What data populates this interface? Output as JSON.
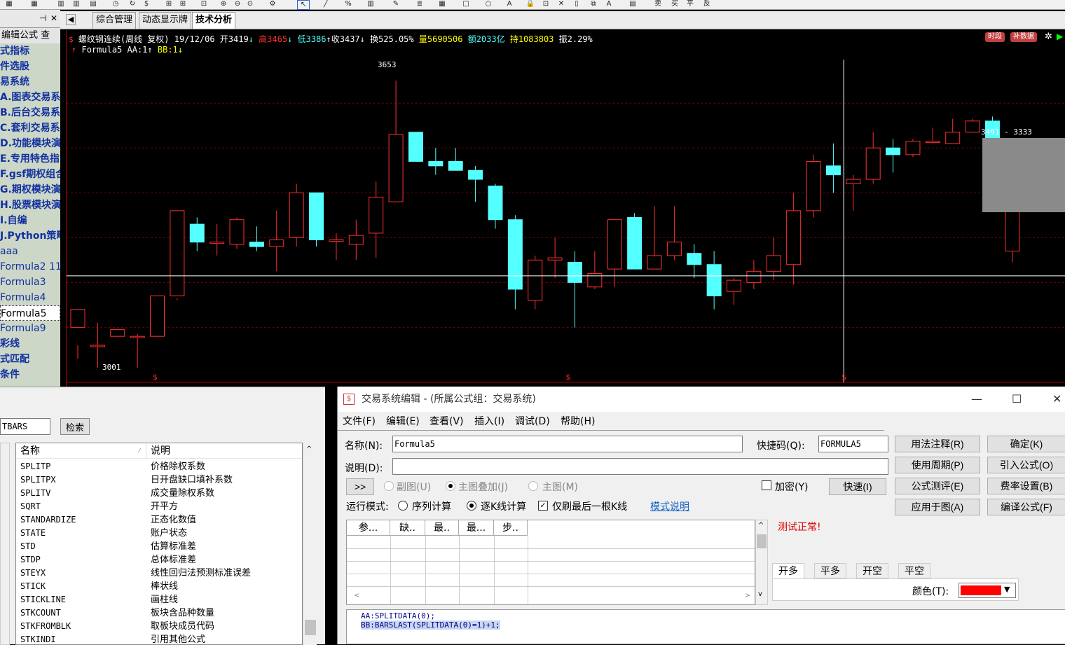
{
  "left_panel": {
    "sub": "编辑公式  查",
    "items": [
      "式指标",
      "件选股",
      "易系统",
      "A.图表交易系",
      "B.后台交易系",
      "C.套利交易系",
      "D.功能模块演",
      "E.专用特色指",
      "F.gsf期权组合",
      "G.期权模块演",
      "H.股票模块演",
      "I.自编",
      "J.Python策略",
      "aaa",
      "Formula2 11",
      "Formula3",
      "Formula4",
      "Formula5",
      "Formula9",
      "彩线",
      "式匹配",
      "条件"
    ]
  },
  "tabs": [
    "综合管理",
    "动态显示牌",
    "技术分析"
  ],
  "chart": {
    "title": "螺纹钢连续(周线 复权) 19/12/06",
    "open": "开3419",
    "high": "高3465",
    "low": "低3386",
    "close": "收3437",
    "turnover": "换525.05%",
    "volume": "量5690506",
    "amount": "额2033亿",
    "position": "持1083803",
    "amplitude": "振2.29%",
    "formula_line": "Formula5  AA:1",
    "bb": "BB:1",
    "btn_time": "时段",
    "btn_data": "补数据",
    "high_mark": "3653",
    "low_mark": "3001",
    "range_mark": "3491 - 3333",
    "colors": {
      "up": "#ff3030",
      "down": "#54ffff",
      "grid": "#7a0000"
    }
  },
  "chart_data": {
    "type": "candlestick",
    "title": "螺纹钢连续(周线 复权)",
    "ohlc": [
      [
        3100,
        3140,
        3060,
        3030
      ],
      [
        3060,
        3060,
        3110,
        3010
      ],
      [
        3080,
        3095,
        3070,
        3070
      ],
      [
        3080,
        3080,
        3085,
        3010
      ],
      [
        3080,
        3170,
        3060,
        3060
      ],
      [
        3170,
        3360,
        3165,
        3160
      ],
      [
        3330,
        3290,
        3345,
        3270
      ],
      [
        3290,
        3290,
        3330,
        3260
      ],
      [
        3285,
        3340,
        3345,
        3275
      ],
      [
        3290,
        3280,
        3325,
        3270
      ],
      [
        3280,
        3295,
        3360,
        3225
      ],
      [
        3300,
        3400,
        3420,
        3280
      ],
      [
        3400,
        3295,
        3400,
        3280
      ],
      [
        3295,
        3295,
        3310,
        3250
      ],
      [
        3285,
        3305,
        3340,
        3250
      ],
      [
        3310,
        3390,
        3425,
        3255
      ],
      [
        3380,
        3530,
        3650,
        3385
      ],
      [
        3535,
        3470,
        3535,
        3480
      ],
      [
        3470,
        3460,
        3500,
        3440
      ],
      [
        3470,
        3450,
        3500,
        3450
      ],
      [
        3450,
        3430,
        3460,
        3380
      ],
      [
        3415,
        3340,
        3420,
        3320
      ],
      [
        3340,
        3185,
        3350,
        3140
      ],
      [
        3160,
        3250,
        3260,
        3140
      ],
      [
        3250,
        3255,
        3300,
        3210
      ],
      [
        3245,
        3200,
        3270,
        3100
      ],
      [
        3190,
        3220,
        3270,
        3185
      ],
      [
        3230,
        3340,
        3340,
        3190
      ],
      [
        3345,
        3230,
        3355,
        3230
      ],
      [
        3230,
        3260,
        3370,
        3230
      ],
      [
        3260,
        3290,
        3370,
        3250
      ],
      [
        3265,
        3240,
        3285,
        3210
      ],
      [
        3240,
        3170,
        3270,
        3140
      ],
      [
        3180,
        3205,
        3210,
        3150
      ],
      [
        3200,
        3225,
        3250,
        3185
      ],
      [
        3225,
        3260,
        3300,
        3205
      ],
      [
        3240,
        3360,
        3400,
        3195
      ],
      [
        3360,
        3470,
        3485,
        3345
      ],
      [
        3460,
        3440,
        3510,
        3400
      ],
      [
        3420,
        3430,
        3440,
        3360
      ],
      [
        3430,
        3500,
        3535,
        3420
      ],
      [
        3500,
        3485,
        3520,
        3445
      ],
      [
        3485,
        3515,
        3520,
        3480
      ],
      [
        3515,
        3515,
        3545,
        3510
      ],
      [
        3510,
        3535,
        3565,
        3510
      ],
      [
        3535,
        3560,
        3565,
        3535
      ],
      [
        3560,
        3495,
        3570,
        3460
      ],
      [
        3270,
        3380,
        3360,
        3245
      ]
    ],
    "ylim": [
      2990,
      3700
    ],
    "grid": true
  },
  "func_window": {
    "search_value": "TBARS",
    "search_button": "检索",
    "col_name": "名称",
    "col_desc": "说明",
    "rows": [
      {
        "name": "SPLITP",
        "desc": "价格除权系数"
      },
      {
        "name": "SPLITPX",
        "desc": "日开盘缺口填补系数"
      },
      {
        "name": "SPLITV",
        "desc": "成交量除权系数"
      },
      {
        "name": "SQRT",
        "desc": "开平方"
      },
      {
        "name": "STANDARDIZE",
        "desc": "正态化数值"
      },
      {
        "name": "STATE",
        "desc": "账户状态"
      },
      {
        "name": "STD",
        "desc": "估算标准差"
      },
      {
        "name": "STDP",
        "desc": "总体标准差"
      },
      {
        "name": "STEYX",
        "desc": "线性回归法预测标准误差"
      },
      {
        "name": "STICK",
        "desc": "棒状线"
      },
      {
        "name": "STICKLINE",
        "desc": "画柱线"
      },
      {
        "name": "STKCOUNT",
        "desc": "板块含品种数量"
      },
      {
        "name": "STKFROMBLK",
        "desc": "取板块成员代码"
      },
      {
        "name": "STKINDI",
        "desc": "引用其他公式"
      }
    ]
  },
  "editor": {
    "title": "交易系统编辑 - (所属公式组：交易系统)",
    "menu": [
      "文件(F)",
      "编辑(E)",
      "查看(V)",
      "插入(I)",
      "调试(D)",
      "帮助(H)"
    ],
    "name_label": "名称(N):",
    "name_value": "Formula5",
    "shortcut_label": "快捷码(Q):",
    "shortcut_value": "FORMULA5",
    "desc_label": "说明(D):",
    "desc_value": "",
    "expand_btn": ">>",
    "radio_sub": "副图(U)",
    "radio_overlay": "主图叠加(J)",
    "radio_main": "主图(M)",
    "encrypt": "加密(Y)",
    "fast_btn": "快速(I)",
    "run_mode": "运行模式:",
    "seq_calc": "序列计算",
    "bar_calc": "逐K线计算",
    "last_bar": "仅刷最后一根K线",
    "mode_help": "模式说明",
    "param_cols": [
      "参...",
      "缺..",
      "最..",
      "最...",
      "步.."
    ],
    "test_status": "测试正常!",
    "order_tabs": [
      "开多",
      "平多",
      "开空",
      "平空"
    ],
    "color_label": "颜色(T):",
    "color_value": "#ff0000",
    "buttons_right": [
      "用法注释(R)",
      "确定(K)",
      "使用周期(P)",
      "引入公式(O)",
      "公式测评(E)",
      "费率设置(B)",
      "应用于图(A)",
      "编译公式(F)"
    ],
    "code_line1": "AA:SPLITDATA(0);",
    "code_line2": "BB:BARSLAST(SPLITDATA(0)=1)+1;"
  }
}
